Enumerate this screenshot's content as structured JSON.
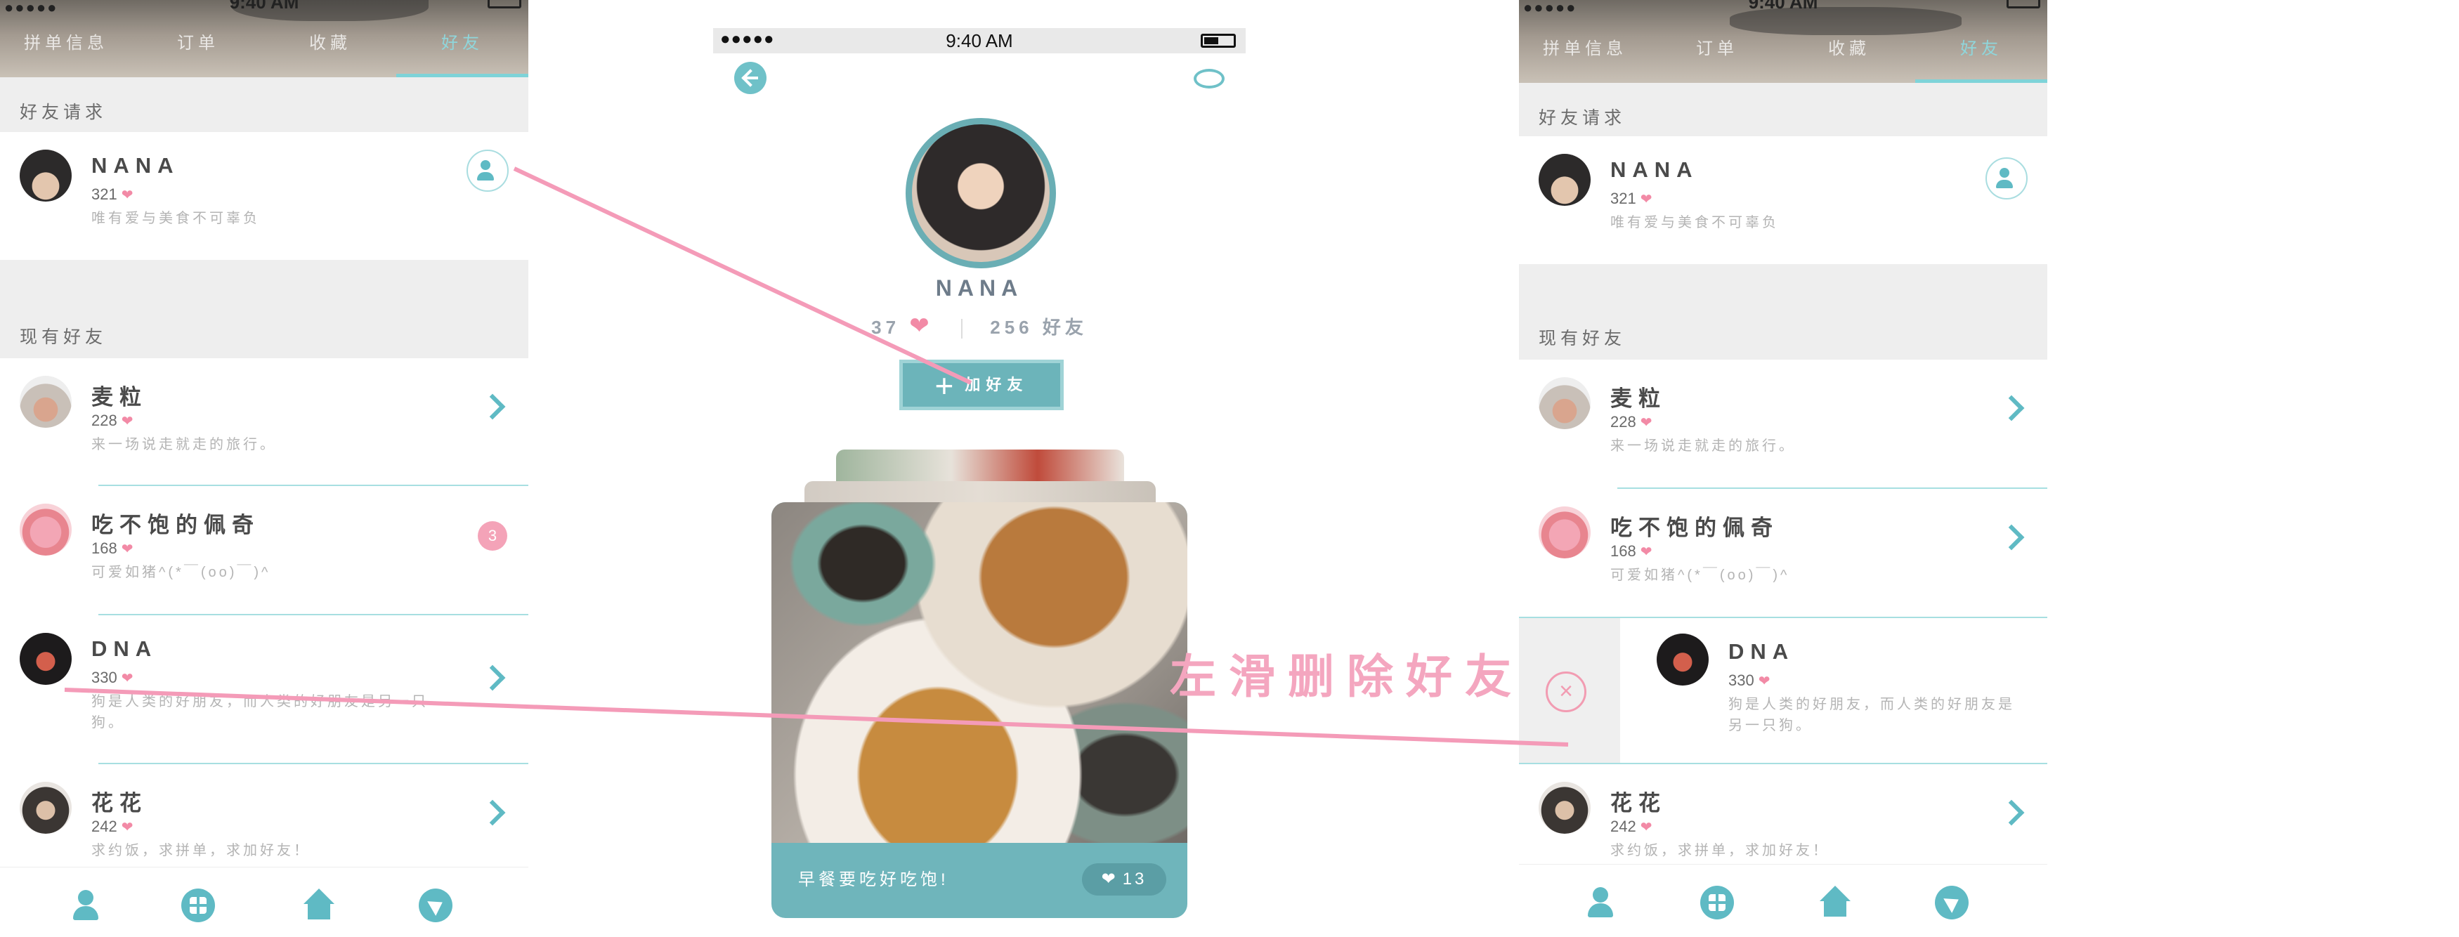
{
  "status_bar": {
    "time": "9:40 AM",
    "signal": "●●●●●"
  },
  "tabs": [
    "拼单信息",
    "订单",
    "收藏",
    "好友"
  ],
  "sections": {
    "requests": "好友请求",
    "existing": "现有好友"
  },
  "friend_request": {
    "name": "NANA",
    "count": "321",
    "bio": "唯有爱与美食不可辜负"
  },
  "friends": [
    {
      "name": "麦粒",
      "count": "228",
      "bio": "来一场说走就走的旅行。"
    },
    {
      "name": "吃不饱的佩奇",
      "count": "168",
      "bio": "可爱如猪^(*￣(oo)￣)^",
      "badge": "3"
    },
    {
      "name": "DNA",
      "count": "330",
      "bio": "狗是人类的好朋友，而人类的好朋友是另一只狗。"
    },
    {
      "name": "花花",
      "count": "242",
      "bio": "求约饭，求拼单，求加好友！"
    }
  ],
  "profile": {
    "name": "NANA",
    "likes": "37",
    "friends_count": "256 好友",
    "add_button": "加好友",
    "post_caption": "早餐要吃好吃饱!",
    "post_likes": "13"
  },
  "annotation": {
    "swipe_delete": "左滑删除好友",
    "color": "#f4a6bf"
  },
  "colors": {
    "accent": "#5fbac4",
    "heart": "#f28aa6",
    "badge": "#f4a3b8",
    "card": "#6fb5bb"
  },
  "icons": {
    "nav": [
      "person-icon",
      "grid-icon",
      "home-icon",
      "play-icon"
    ],
    "request_action": "add-friend-icon",
    "back": "back-arrow-icon",
    "chat": "chat-icon",
    "delete": "close-icon"
  }
}
